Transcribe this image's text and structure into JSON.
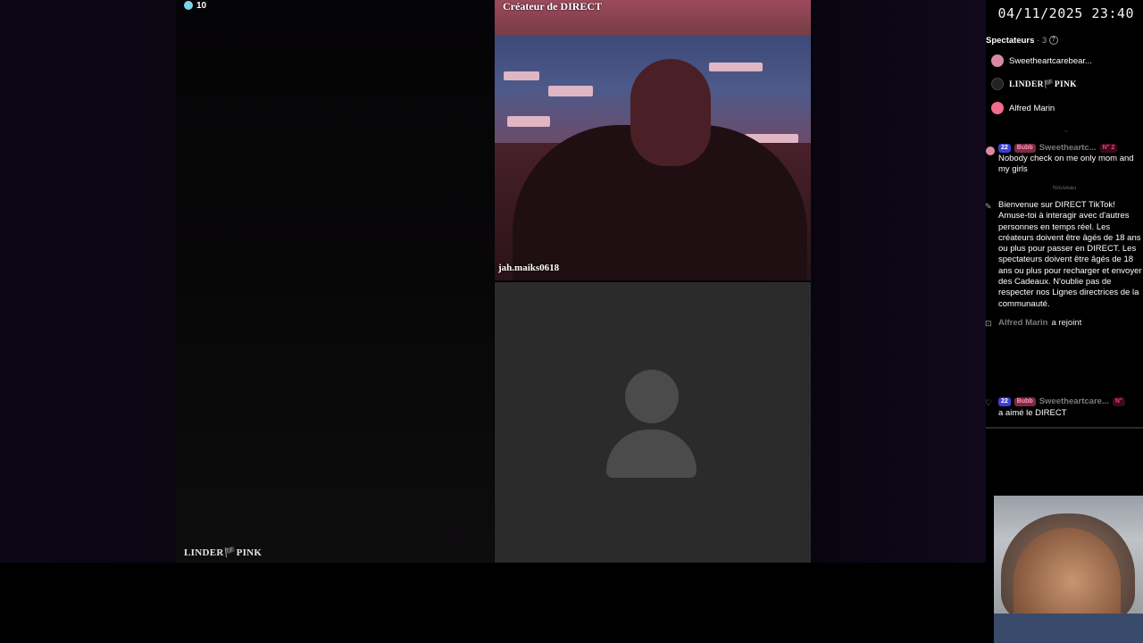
{
  "stream": {
    "viewer_count": "10",
    "host_name": "LINDER🏴PINK",
    "top_cam_label": "Créateur de DIRECT",
    "top_cam_user": "jah.maiks0618"
  },
  "overlay": {
    "datetime": "04/11/2025 23:40"
  },
  "sidebar": {
    "spectators_label": "Spectateurs",
    "spectators_count": "· 3",
    "spectators": [
      {
        "name": "Sweetheartcarebear...",
        "avatar_color": "#d98aa3"
      },
      {
        "name": "LINDER🏴PINK",
        "avatar_color": "#222222"
      },
      {
        "name": "Alfred Marin",
        "avatar_color": "#f06c8c"
      }
    ],
    "new_divider": "Nouveau",
    "chat": [
      {
        "level": "22",
        "fan_badge": "Bubb",
        "user": "Sweetheartc...",
        "rank": "N° 2",
        "text": "Nobody check on me only mom and my girls"
      },
      {
        "text": "Bienvenue sur DIRECT TikTok! Amuse-toi à interagir avec d'autres personnes en temps réel. Les créateurs doivent être âgés de 18 ans ou plus pour passer en DIRECT. Les spectateurs doivent être âgés de 18 ans ou plus pour recharger et envoyer des Cadeaux. N'oublie pas de respecter nos Lignes directrices de la communauté."
      },
      {
        "user": "Alfred Marin",
        "action": "a rejoint"
      },
      {
        "level": "22",
        "fan_badge": "Bubb",
        "user": "Sweetheartcare...",
        "rank": "N°",
        "text": "a aimé le DIRECT"
      }
    ]
  },
  "colors": {
    "level_badge": "#3d3ed6",
    "fan_badge": "#7d2a43",
    "viewer_icon": "#7fd3e8"
  }
}
